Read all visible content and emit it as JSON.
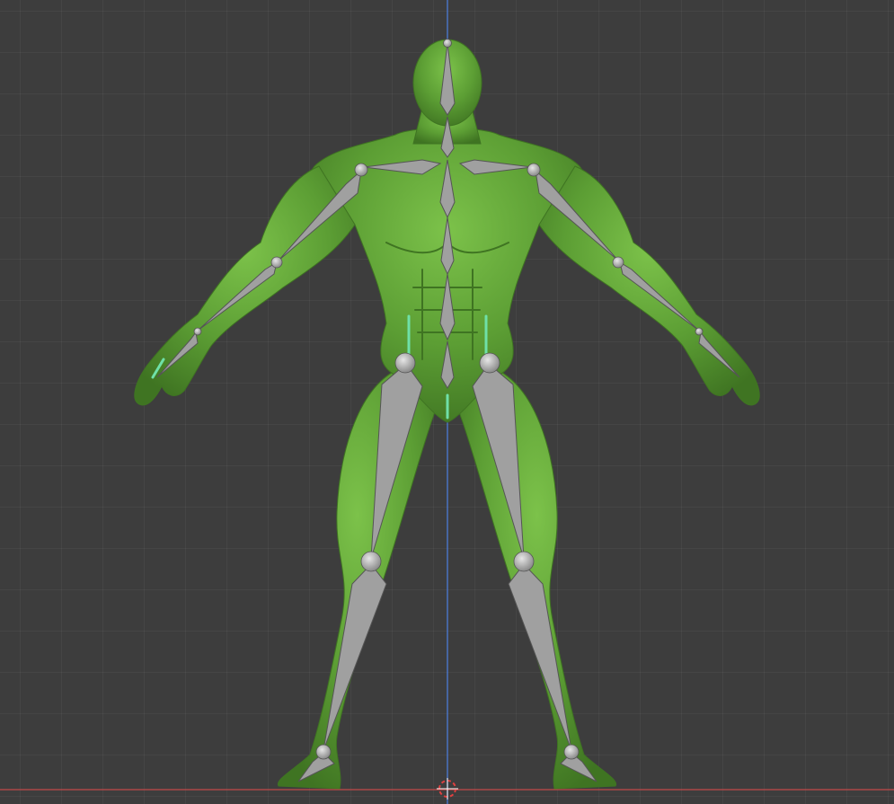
{
  "viewport": {
    "view": "front-orthographic",
    "background_color": "#3d3d3d",
    "grid": true
  },
  "axes": {
    "z_axis_color": "#4c7bd6",
    "x_axis_color": "#c24a4a"
  },
  "mesh": {
    "object_type": "humanoid-character",
    "color": "#5c9e34",
    "highlight_color": "#7cc24a",
    "shadow_color": "#3f7422"
  },
  "armature": {
    "display": "octahedral",
    "bone_color": "#a0a0a0",
    "bone_outline_color": "#555555",
    "selected_bone_color": "#6fe0a8",
    "bones": [
      "head",
      "neck",
      "spine-upper",
      "spine-mid",
      "spine-lower",
      "pelvis",
      "shoulder-left",
      "shoulder-right",
      "upper-arm-left",
      "upper-arm-right",
      "forearm-left",
      "forearm-right",
      "hand-left",
      "hand-right",
      "thigh-left",
      "thigh-right",
      "shin-left",
      "shin-right",
      "foot-left",
      "foot-right"
    ]
  },
  "cursor_3d": {
    "icon": "3d-cursor-icon",
    "color_a": "#ffffff",
    "color_b": "#e04040"
  }
}
